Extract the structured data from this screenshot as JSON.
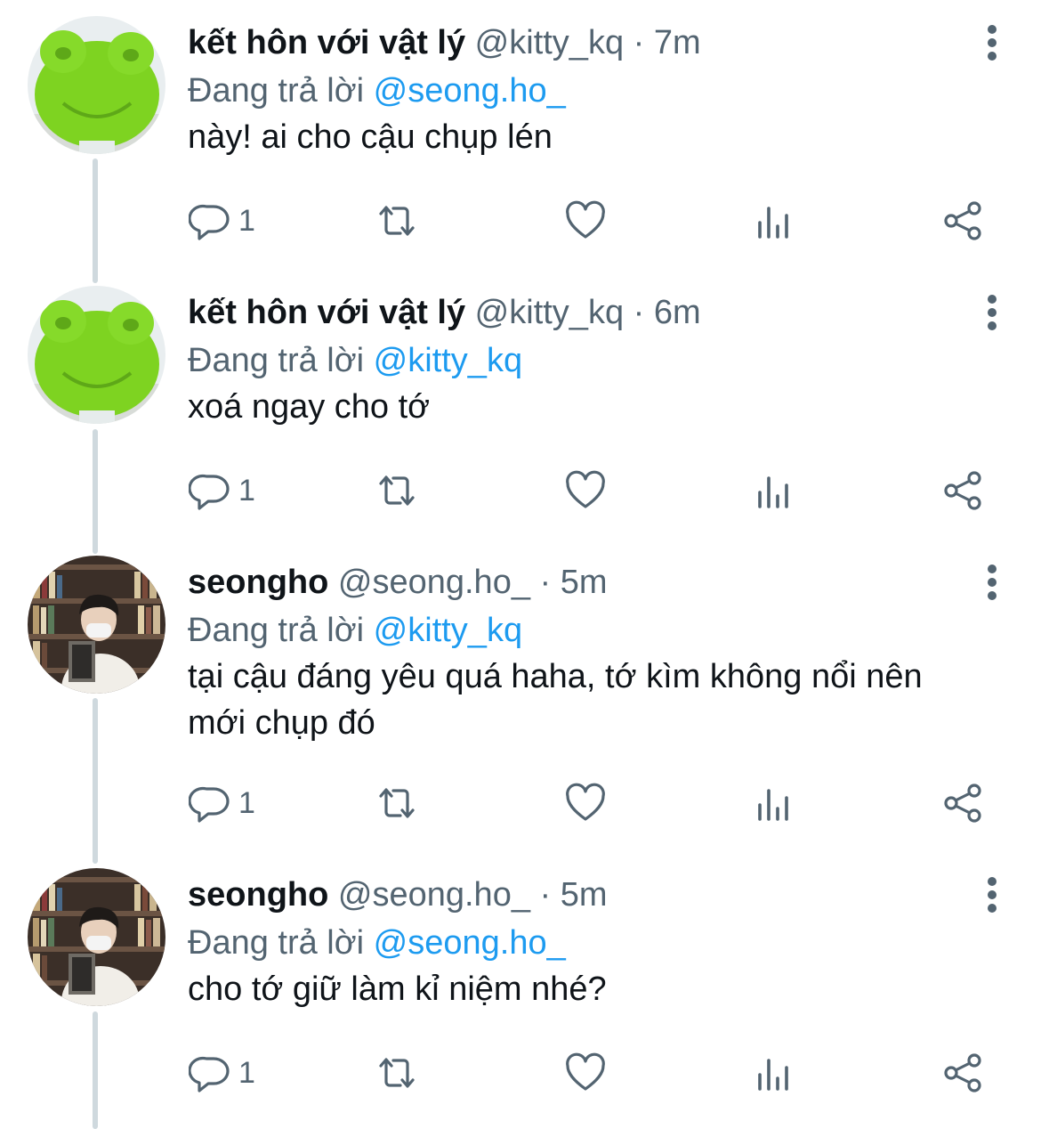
{
  "tweets": [
    {
      "display_name": "kết hôn với vật lý",
      "handle": "@kitty_kq",
      "time": "· 7m",
      "reply_prefix": "Đang trả lời",
      "reply_to": "@seong.ho_",
      "text": "này! ai cho cậu chụp lén",
      "reply_count": "1",
      "avatar": "frog-plush"
    },
    {
      "display_name": "kết hôn với vật lý",
      "handle": "@kitty_kq",
      "time": "· 6m",
      "reply_prefix": "Đang trả lời",
      "reply_to": "@kitty_kq",
      "text": "xoá ngay cho tớ",
      "reply_count": "1",
      "avatar": "frog-plush"
    },
    {
      "display_name": "seongho",
      "handle": "@seong.ho_",
      "time": "· 5m",
      "reply_prefix": "Đang trả lời",
      "reply_to": "@kitty_kq",
      "text": "tại cậu đáng yêu quá haha, tớ kìm không nổi nên mới chụp đó",
      "reply_count": "1",
      "avatar": "person-in-library"
    },
    {
      "display_name": "seongho",
      "handle": "@seong.ho_",
      "time": "· 5m",
      "reply_prefix": "Đang trả lời",
      "reply_to": "@seong.ho_",
      "text": "cho tớ giữ làm kỉ niệm nhé?",
      "reply_count": "1",
      "avatar": "person-in-library"
    }
  ],
  "icons": {
    "reply": "reply-icon",
    "retweet": "retweet-icon",
    "like": "heart-icon",
    "views": "analytics-icon",
    "share": "share-icon",
    "more": "more-vertical-icon"
  },
  "colors": {
    "text": "#0f1419",
    "secondary": "#536471",
    "link": "#1d9bf0",
    "thread_line": "#cfd9de",
    "frog_green": "#7ed321"
  }
}
